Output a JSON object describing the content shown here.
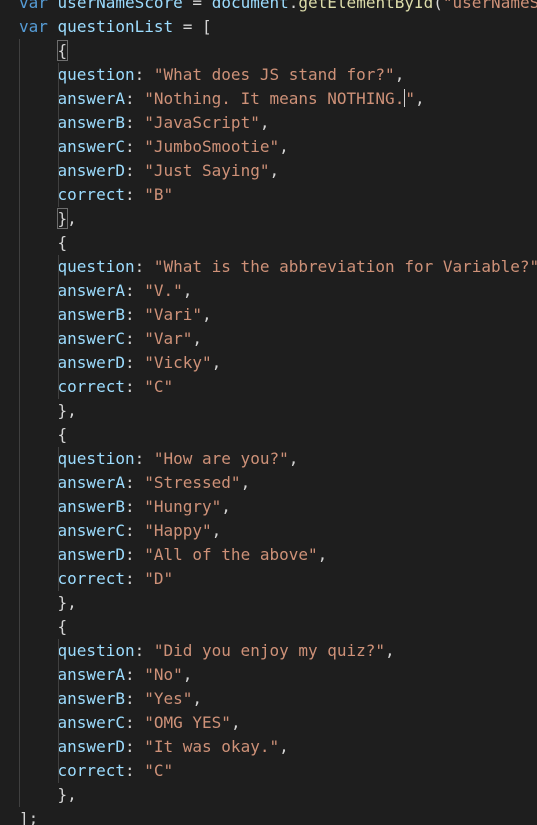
{
  "theme": {
    "background": "#1e1e1e",
    "keyword": "#569cd6",
    "variable": "#9cdcfe",
    "function": "#dcdcaa",
    "string": "#ce9178",
    "punctuation": "#d4d4d4"
  },
  "header_line": {
    "kw": "var",
    "name": "userNameScore",
    "op": " = ",
    "obj": "document",
    "dot": ".",
    "fn": "getElementById",
    "paren": "(",
    "arg": "\"userNameS"
  },
  "list_decl": {
    "kw": "var",
    "name": "questionList",
    "op": " = ",
    "open": "["
  },
  "questions": [
    {
      "question": "\"What does JS stand for?\"",
      "answerA": "\"Nothing. It means NOTHING.",
      "answerA_tail": "\"",
      "answerB": "\"JavaScript\"",
      "answerC": "\"JumboSmootie\"",
      "answerD": "\"Just Saying\"",
      "correct": "\"B\""
    },
    {
      "question": "\"What is the abbreviation for Variable?\"",
      "answerA": "\"V.\"",
      "answerB": "\"Vari\"",
      "answerC": "\"Var\"",
      "answerD": "\"Vicky\"",
      "correct": "\"C\""
    },
    {
      "question": "\"How are you?\"",
      "answerA": "\"Stressed\"",
      "answerB": "\"Hungry\"",
      "answerC": "\"Happy\"",
      "answerD": "\"All of the above\"",
      "correct": "\"D\""
    },
    {
      "question": "\"Did you enjoy my quiz?\"",
      "answerA": "\"No\"",
      "answerB": "\"Yes\"",
      "answerC": "\"OMG YES\"",
      "answerD": "\"It was okay.\"",
      "correct": "\"C\""
    }
  ],
  "keys": {
    "question": "question",
    "answerA": "answerA",
    "answerB": "answerB",
    "answerC": "answerC",
    "answerD": "answerD",
    "correct": "correct"
  },
  "punct": {
    "colon": ": ",
    "comma": ",",
    "open_brace": "{",
    "close_brace": "}",
    "close_brace_comma": "},",
    "close_list": "];"
  }
}
